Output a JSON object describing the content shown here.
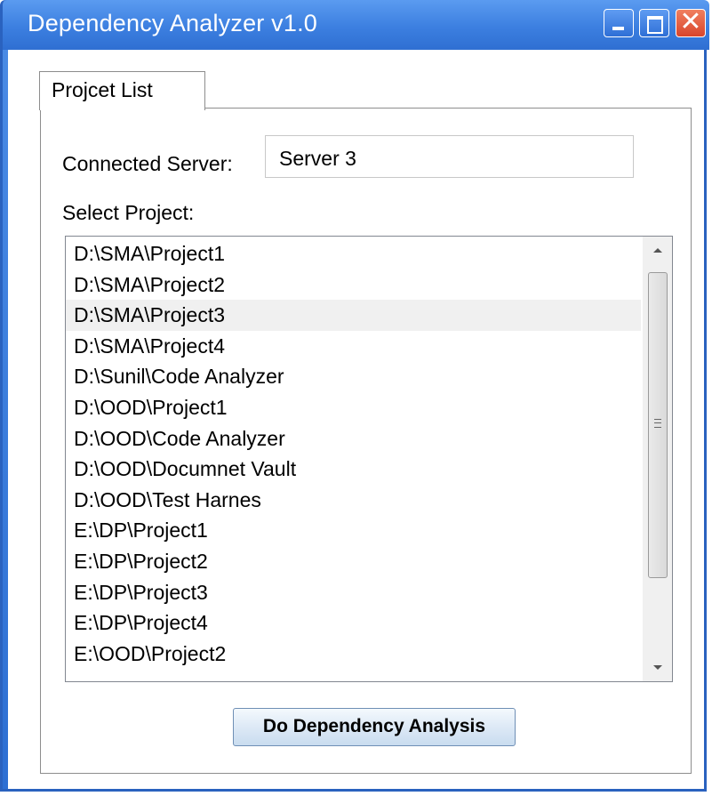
{
  "window": {
    "title": "Dependency Analyzer v1.0",
    "controls": {
      "minimize": "minimize",
      "maximize": "maximize",
      "close": "✕"
    }
  },
  "tabs": [
    {
      "label": "Projcet List",
      "selected": true
    }
  ],
  "form": {
    "server_label": "Connected Server:",
    "server_value": "Server 3",
    "select_label": "Select Project:",
    "action_label": "Do Dependency Analysis"
  },
  "projects": [
    "D:\\SMA\\Project1",
    "D:\\SMA\\Project2",
    "D:\\SMA\\Project3",
    "D:\\SMA\\Project4",
    "D:\\Sunil\\Code Analyzer",
    "D:\\OOD\\Project1",
    "D:\\OOD\\Code Analyzer",
    "D:\\OOD\\Documnet Vault",
    "D:\\OOD\\Test Harnes",
    "E:\\DP\\Project1",
    "E:\\DP\\Project2",
    "E:\\DP\\Project3",
    "E:\\DP\\Project4",
    "E:\\OOD\\Project2"
  ],
  "selected_project": "D:\\SMA\\Project3",
  "colors": {
    "title_bar": "#3c7fe0",
    "close_button": "#d9452c",
    "selection": "#f0f0f0"
  }
}
